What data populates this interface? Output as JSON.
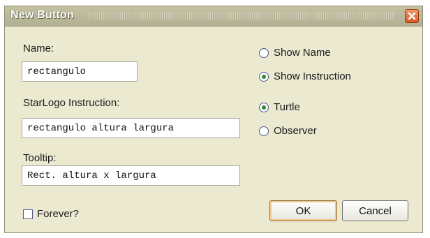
{
  "dialog": {
    "title": "New Button",
    "close_icon": "close-icon"
  },
  "form": {
    "name_label": "Name:",
    "name_value": "rectangulo",
    "instruction_label": "StarLogo Instruction:",
    "instruction_value": "rectangulo altura largura",
    "tooltip_label": "Tooltip:",
    "tooltip_value": "Rect. altura x largura",
    "forever_label": "Forever?",
    "forever_checked": false
  },
  "display_options": [
    {
      "label": "Show Name",
      "selected": false
    },
    {
      "label": "Show Instruction",
      "selected": true
    }
  ],
  "agent_options": [
    {
      "label": "Turtle",
      "selected": true
    },
    {
      "label": "Observer",
      "selected": false
    }
  ],
  "buttons": {
    "ok_label": "OK",
    "cancel_label": "Cancel"
  },
  "colors": {
    "dialog_background": "#ece9d1",
    "titlebar": "#b8b698",
    "close_button": "#d9622b",
    "radio_selected": "#2f8a2f"
  }
}
